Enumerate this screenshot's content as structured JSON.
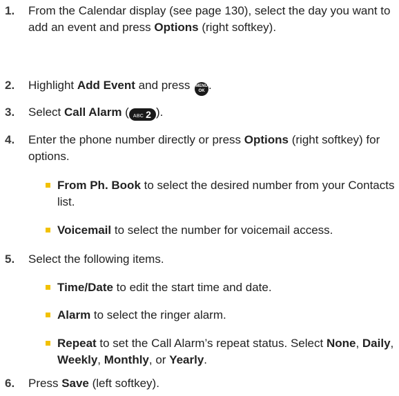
{
  "steps": [
    {
      "num": "1.",
      "parts": [
        {
          "t": "From the Calendar display (see page 130), select the day you want to add an event and press "
        },
        {
          "t": "Options",
          "b": true
        },
        {
          "t": " (right softkey)."
        }
      ]
    },
    {
      "num": "2.",
      "parts": [
        {
          "t": "Highlight "
        },
        {
          "t": "Add Event",
          "b": true
        },
        {
          "t": " and press "
        },
        {
          "key": "menu"
        },
        {
          "t": "."
        }
      ]
    },
    {
      "num": "3.",
      "parts": [
        {
          "t": "Select "
        },
        {
          "t": "Call Alarm",
          "b": true
        },
        {
          "t": " ("
        },
        {
          "key": "abc"
        },
        {
          "t": ")."
        }
      ]
    },
    {
      "num": "4.",
      "parts": [
        {
          "t": "Enter the phone number directly or press "
        },
        {
          "t": "Options",
          "b": true
        },
        {
          "t": " (right softkey) for options."
        }
      ],
      "subs": [
        [
          {
            "t": "From Ph. Book",
            "b": true
          },
          {
            "t": " to select the desired number from your Contacts list."
          }
        ],
        [
          {
            "t": "Voicemail",
            "b": true
          },
          {
            "t": " to select the number for voicemail access."
          }
        ]
      ]
    },
    {
      "num": "5.",
      "parts": [
        {
          "t": "Select the following items."
        }
      ],
      "subs": [
        [
          {
            "t": "Time/Date",
            "b": true
          },
          {
            "t": " to edit the start time and date."
          }
        ],
        [
          {
            "t": "Alarm",
            "b": true
          },
          {
            "t": " to select the ringer alarm."
          }
        ],
        [
          {
            "t": "Repeat",
            "b": true
          },
          {
            "t": " to set the Call Alarm’s repeat status. Select "
          },
          {
            "t": "None",
            "b": true
          },
          {
            "t": ", "
          },
          {
            "t": "Daily",
            "b": true
          },
          {
            "t": ", "
          },
          {
            "t": "Weekly",
            "b": true
          },
          {
            "t": ", "
          },
          {
            "t": "Monthly",
            "b": true
          },
          {
            "t": ", or "
          },
          {
            "t": "Yearly",
            "b": true
          },
          {
            "t": "."
          }
        ]
      ]
    },
    {
      "num": "6.",
      "parts": [
        {
          "t": "Press "
        },
        {
          "t": "Save",
          "b": true
        },
        {
          "t": " (left softkey)."
        }
      ]
    }
  ],
  "keys": {
    "menu": {
      "line1": "MENU",
      "line2": "OK",
      "icon": "menu-ok-key-icon"
    },
    "abc": {
      "small": "ABC",
      "big": "2",
      "icon": "abc-2-key-icon"
    }
  },
  "colors": {
    "bullet": "#f2c100",
    "text": "#222222",
    "number": "#3a3a3a"
  }
}
